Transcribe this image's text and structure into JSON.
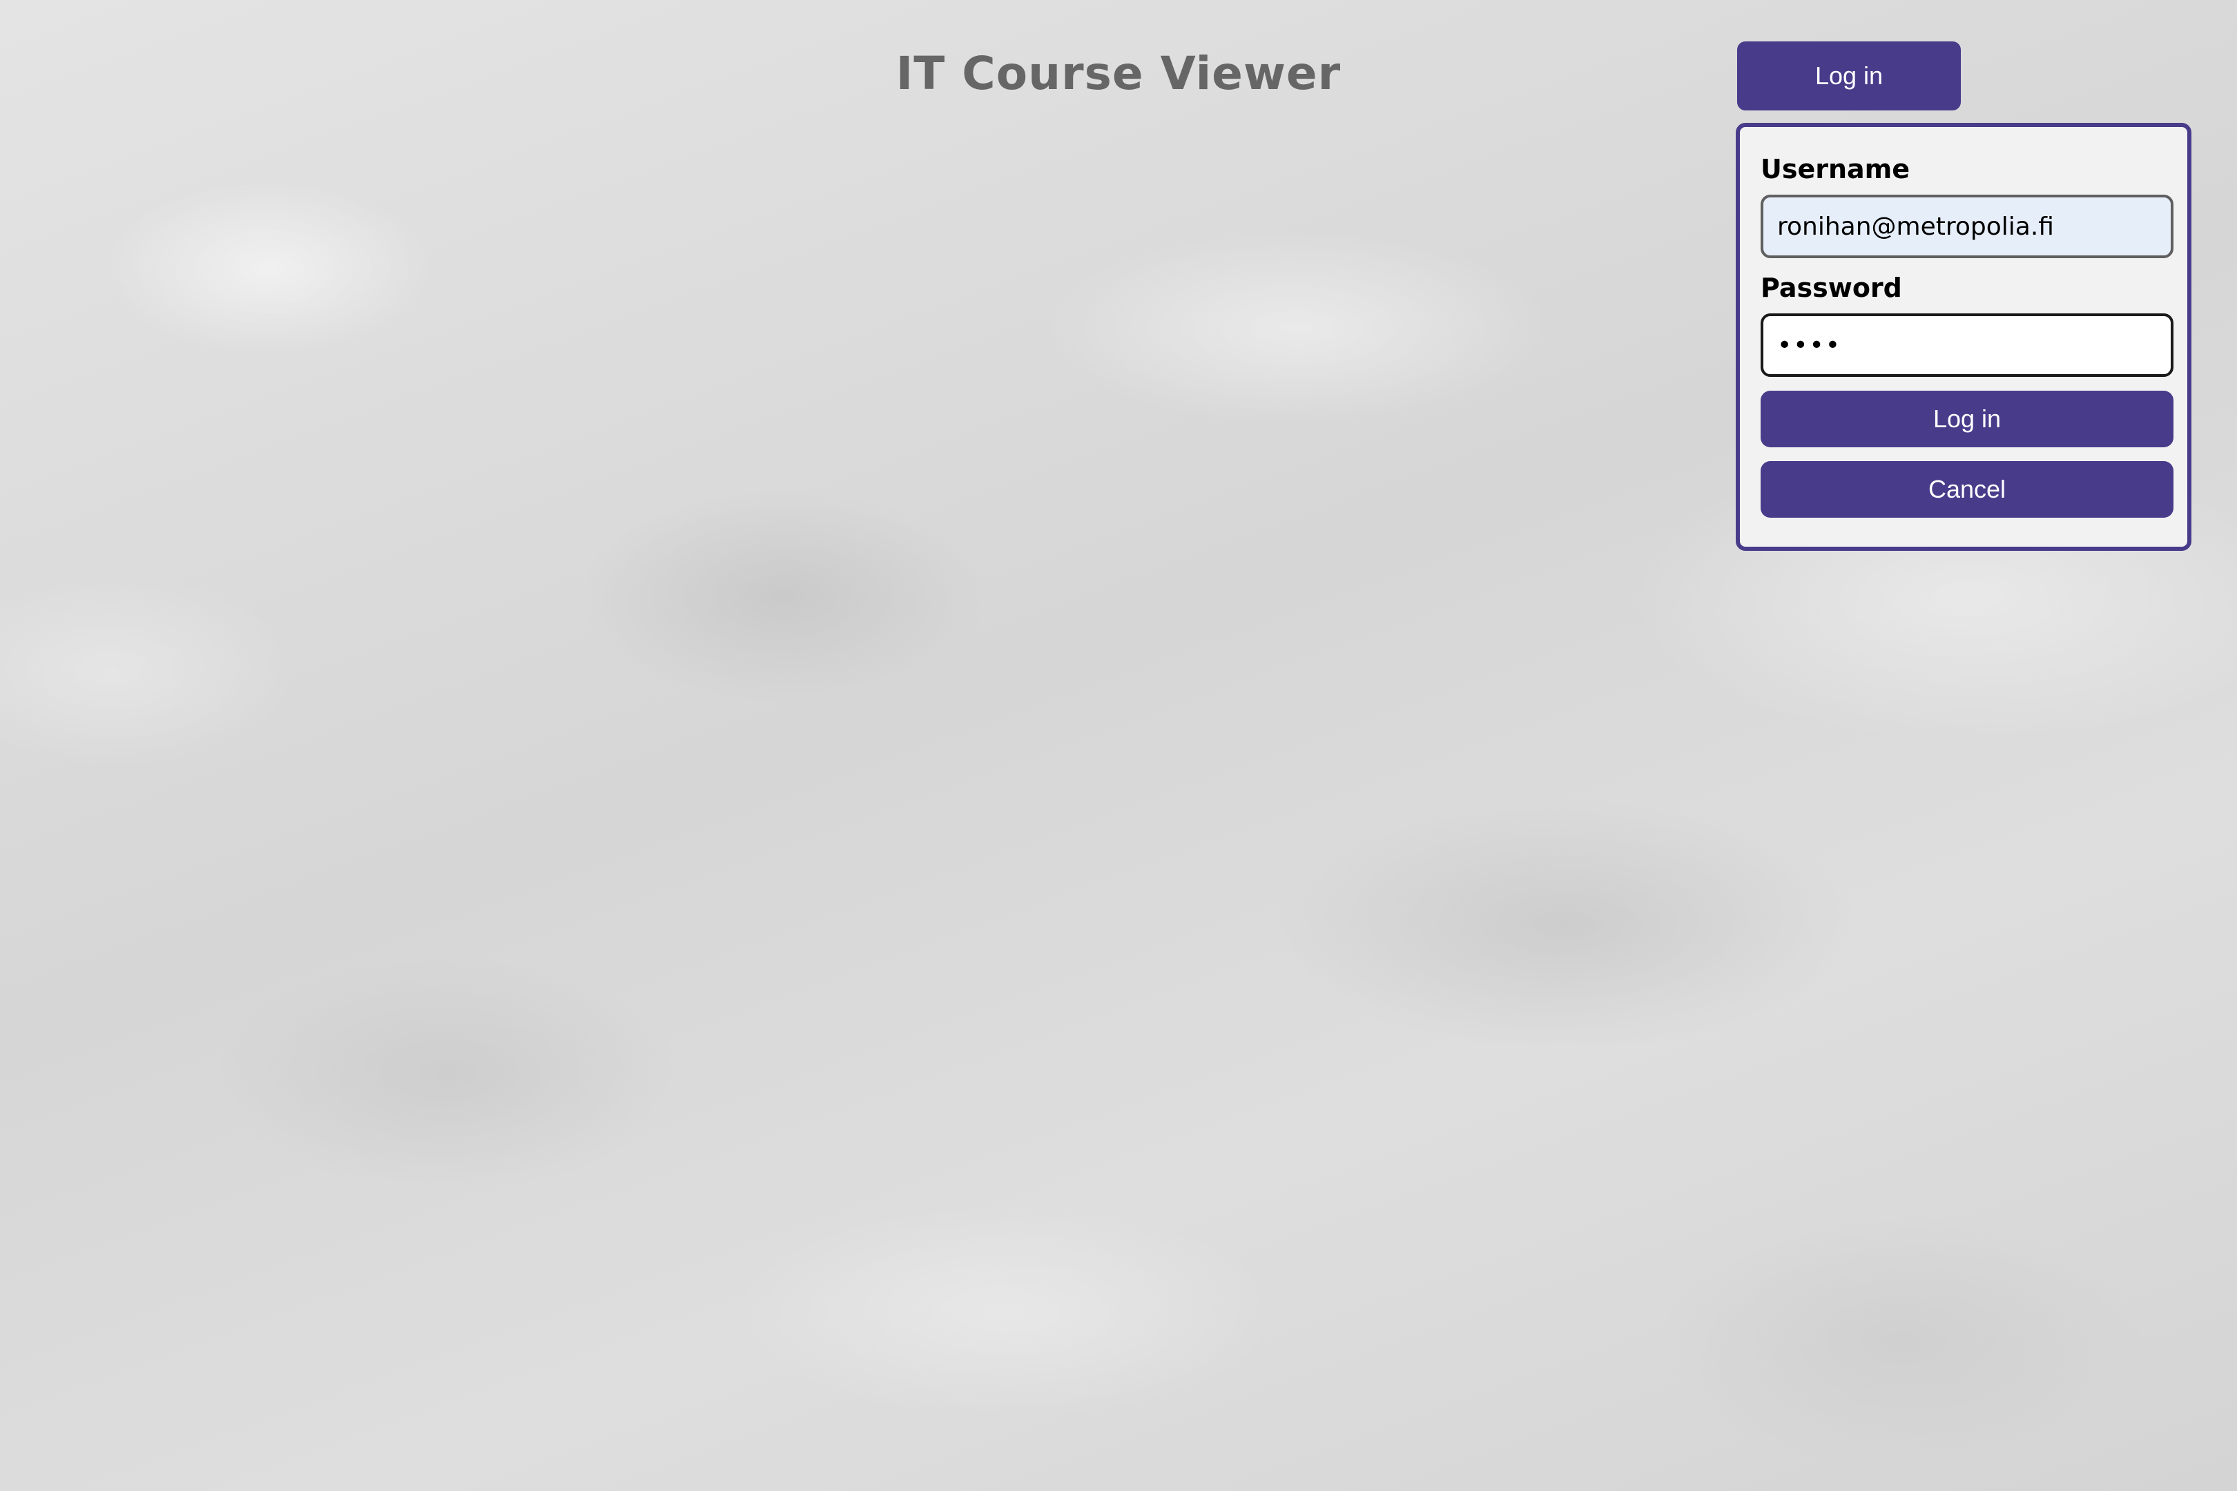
{
  "header": {
    "title": "IT Course Viewer",
    "login_button_label": "Log in"
  },
  "login_form": {
    "username_label": "Username",
    "username_value": "ronihan@metropolia.fi",
    "password_label": "Password",
    "password_value": "••••",
    "submit_label": "Log in",
    "cancel_label": "Cancel"
  },
  "colors": {
    "accent": "#483b8a",
    "title": "#666666",
    "autofill_background": "#e6eefa"
  }
}
